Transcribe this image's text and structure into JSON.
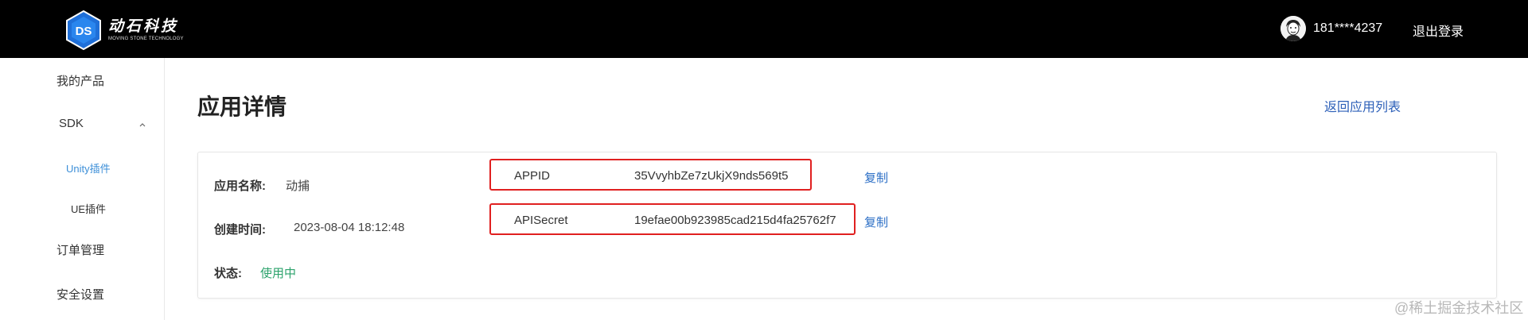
{
  "header": {
    "brand_name": "动石科技",
    "brand_subtitle": "MOVING STONE TECHNOLOGY",
    "user_phone": "181****4237",
    "logout_label": "退出登录"
  },
  "sidebar": {
    "items": [
      {
        "label": "我的产品"
      },
      {
        "label": "SDK"
      },
      {
        "label": "Unity插件"
      },
      {
        "label": "UE插件"
      },
      {
        "label": "订单管理"
      },
      {
        "label": "安全设置"
      }
    ],
    "active": "Unity插件"
  },
  "main": {
    "title": "应用详情",
    "back_link": "返回应用列表",
    "app_name_label": "应用名称:",
    "app_name_value": "动捕",
    "created_label": "创建时间:",
    "created_value": "2023-08-04 18:12:48",
    "status_label": "状态:",
    "status_value": "使用中",
    "keys": [
      {
        "name": "APPID",
        "value": "35VvyhbZe7zUkjX9nds569t5",
        "copy_label": "复制"
      },
      {
        "name": "APISecret",
        "value": "19efae00b923985cad215d4fa25762f7",
        "copy_label": "复制"
      }
    ]
  },
  "watermark": "@稀土掘金技术社区",
  "colors": {
    "topbar": "#000000",
    "accent_blue": "#2c6fc6",
    "status_green": "#2ba26b",
    "highlight_red": "#e02020"
  }
}
